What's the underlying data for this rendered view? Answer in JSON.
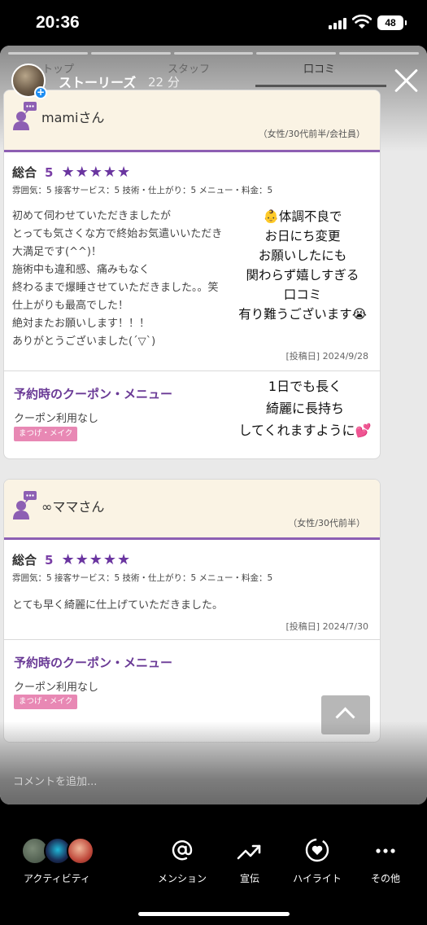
{
  "status_bar": {
    "time": "20:36",
    "battery": "48"
  },
  "story": {
    "username": "ストーリーズ",
    "time_ago": "22 分",
    "site_tabs": [
      "トップ",
      "スタッフ",
      "口コミ"
    ],
    "comment_placeholder": "コメントを追加..."
  },
  "reviews": [
    {
      "reviewer": "mamiさん",
      "meta": "（女性/30代前半/会社員）",
      "rating_label": "総合",
      "score": "5",
      "stars": "★★★★★",
      "sub_ratings": "雰囲気：5  接客サービス：5  技術・仕上がり：5  メニュー・料金：5",
      "comment": "初めて伺わせていただきましたが\nとっても気さくな方で終始お気遣いいただき\n大満足です(^^)！\n施術中も違和感、痛みもなく\n終わるまで爆睡させていただきました。。笑\n仕上がりも最高でした！\n絶対またお願いします！！！\nありがとうございました(´▽`)",
      "posted": "[投稿日] 2024/9/28",
      "coupon_title": "予約時のクーポン・メニュー",
      "coupon_text": "クーポン利用なし",
      "tag": "まつげ・メイク"
    },
    {
      "reviewer": "∞ママさん",
      "meta": "（女性/30代前半）",
      "rating_label": "総合",
      "score": "5",
      "stars": "★★★★★",
      "sub_ratings": "雰囲気：5  接客サービス：5  技術・仕上がり：5  メニュー・料金：5",
      "comment": "とても早く綺麗に仕上げていただきました。",
      "posted": "[投稿日] 2024/7/30",
      "coupon_title": "予約時のクーポン・メニュー",
      "coupon_text": "クーポン利用なし",
      "tag": "まつげ・メイク"
    }
  ],
  "overlays": {
    "text1": "👶体調不良で\nお日にち変更\nお願いしたにも\n関わらず嬉しすぎる\n口コミ\n有り難うございます😭",
    "text2": "1日でも長く\n綺麗に長持ち\nしてくれますように💕"
  },
  "actions": [
    {
      "label": "アクティビティ",
      "icon": "activity-avatars"
    },
    {
      "label": "メンション",
      "icon": "at-icon"
    },
    {
      "label": "宣伝",
      "icon": "trend-icon"
    },
    {
      "label": "ハイライト",
      "icon": "highlight-heart-icon"
    },
    {
      "label": "その他",
      "icon": "more-icon"
    }
  ],
  "colors": {
    "accent": "#6a35a0",
    "card_header": "#faf3e4",
    "tag": "#e888b4"
  }
}
